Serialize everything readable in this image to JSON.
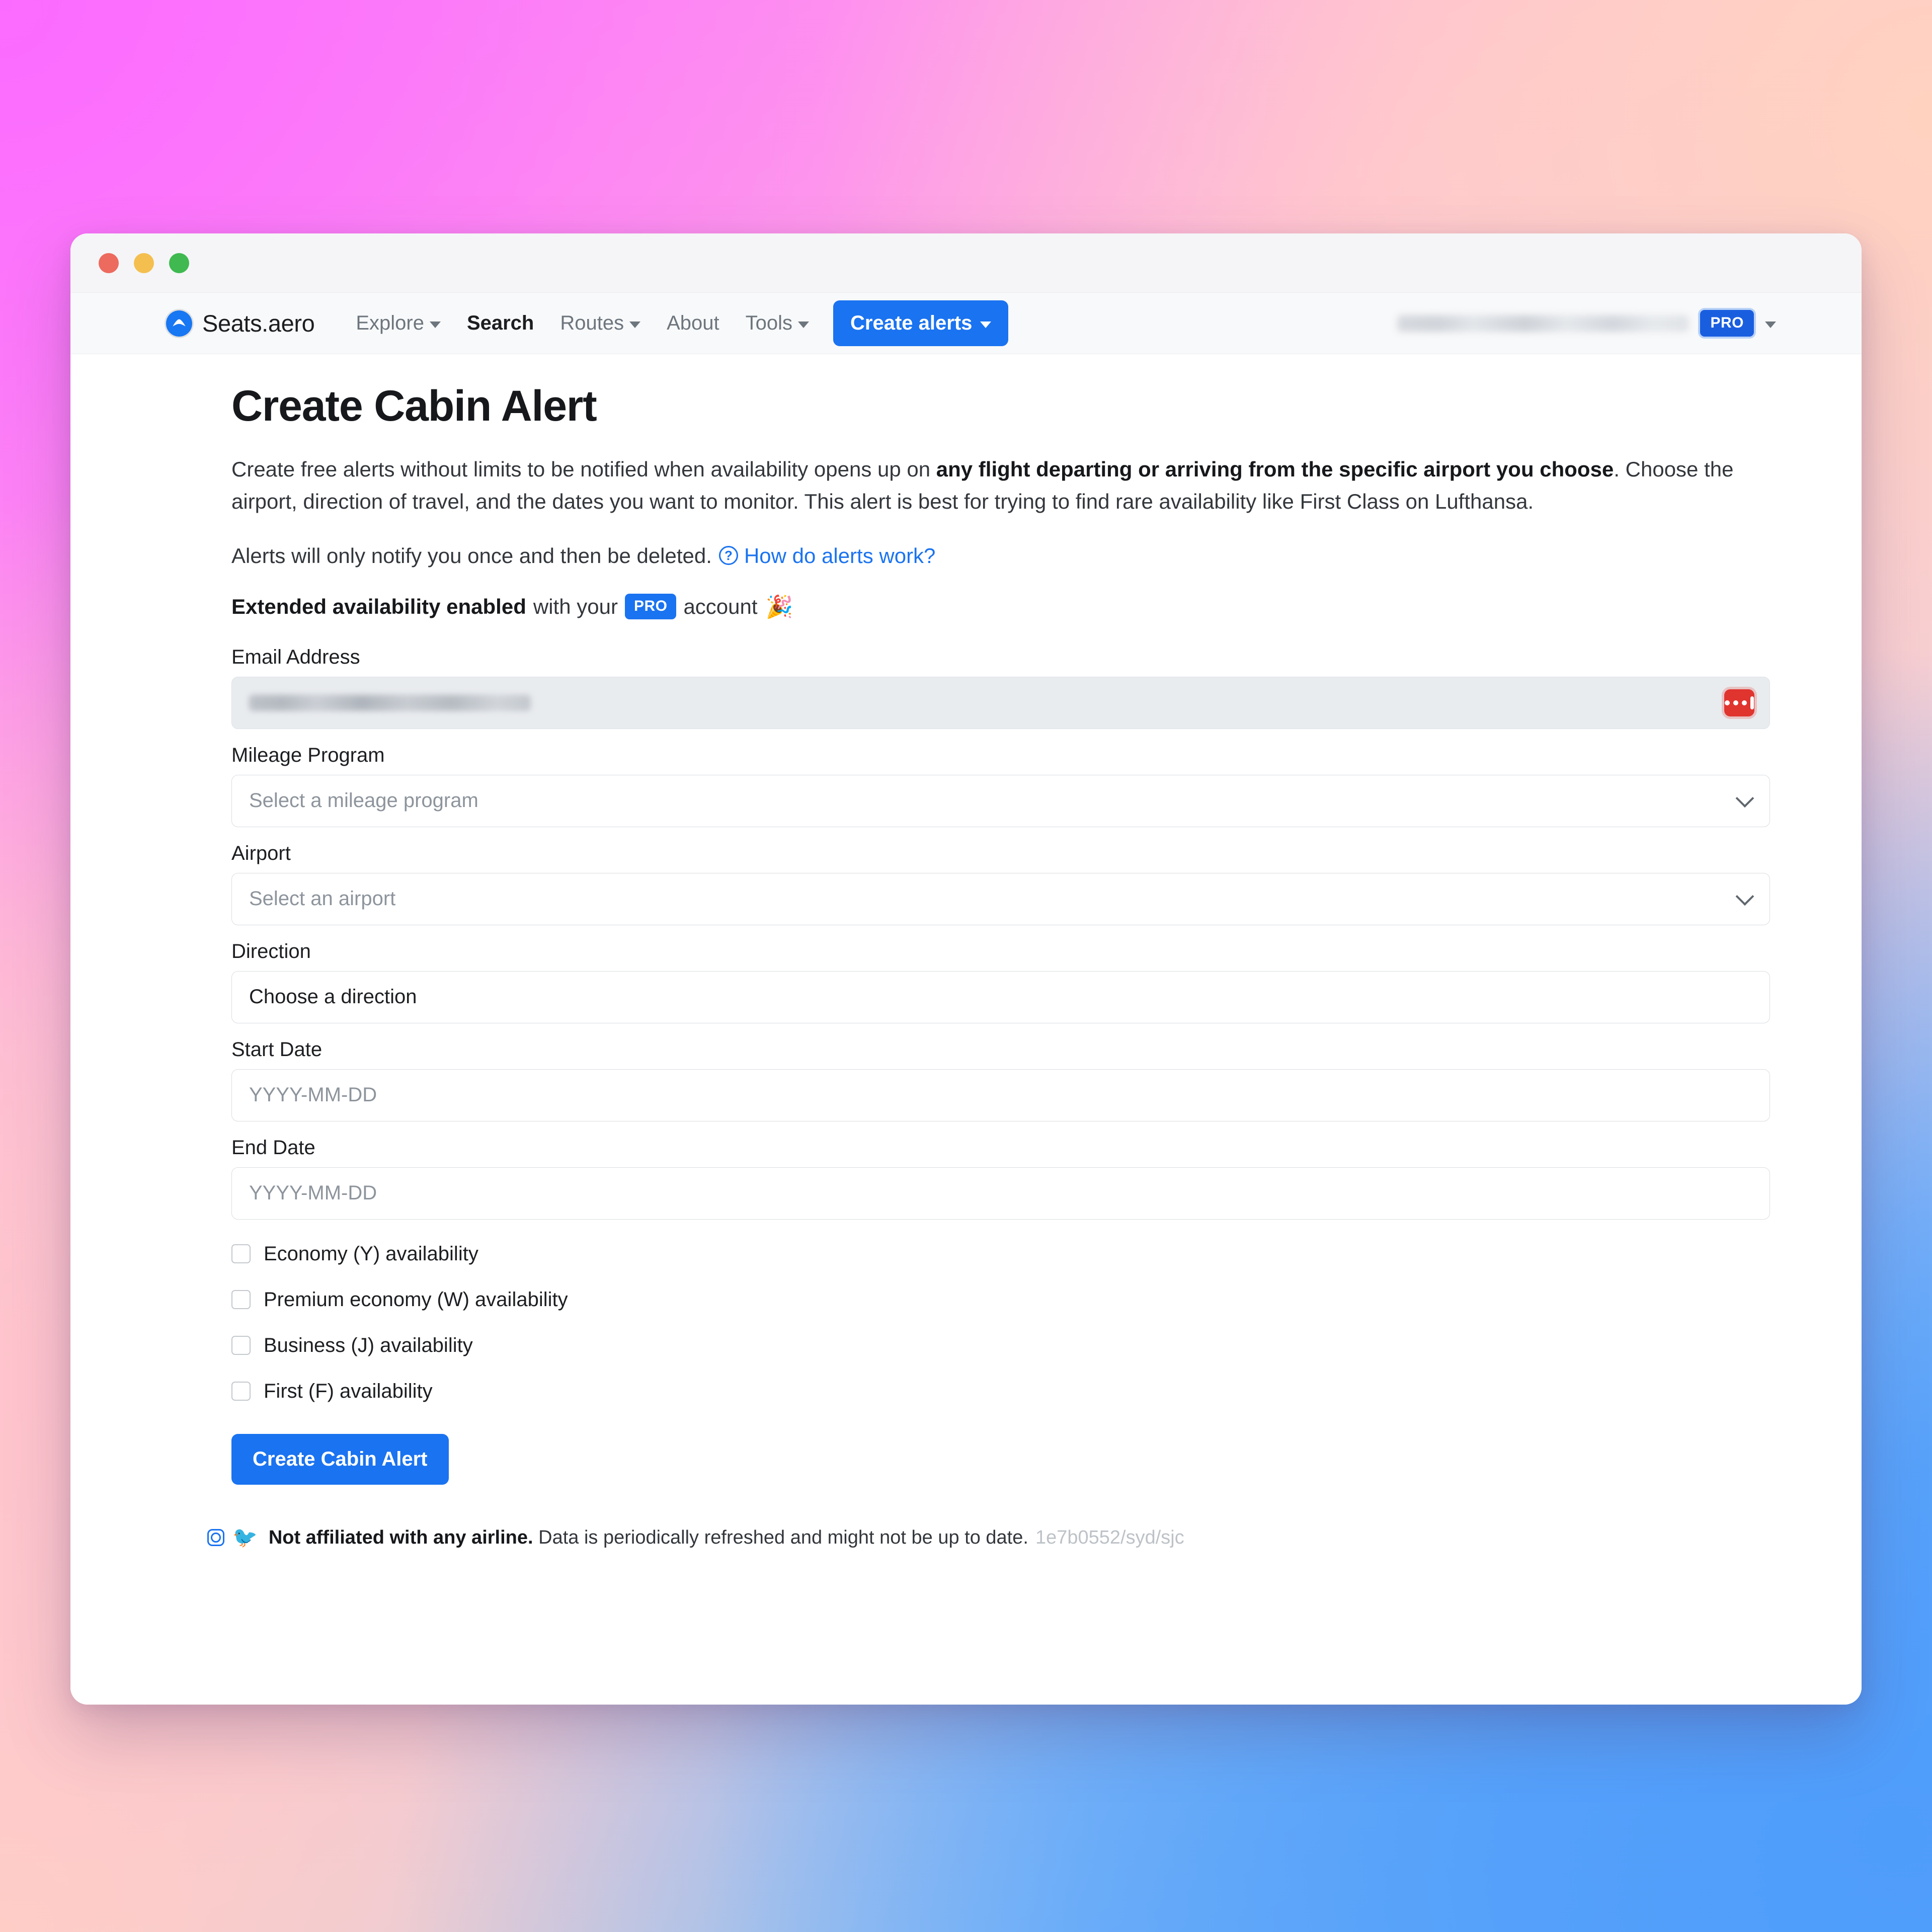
{
  "window": {
    "traffic_lights": [
      "close",
      "minimize",
      "zoom"
    ]
  },
  "navbar": {
    "brand": "Seats.aero",
    "links": [
      {
        "label": "Explore",
        "has_caret": true,
        "strong": false
      },
      {
        "label": "Search",
        "has_caret": false,
        "strong": true
      },
      {
        "label": "Routes",
        "has_caret": true,
        "strong": false
      },
      {
        "label": "About",
        "has_caret": false,
        "strong": false
      },
      {
        "label": "Tools",
        "has_caret": true,
        "strong": false
      }
    ],
    "cta_label": "Create alerts",
    "account": {
      "email_redacted": true,
      "badge": "PRO"
    },
    "accent_color": "#1a73f0"
  },
  "main": {
    "title": "Create Cabin Alert",
    "lede_part1": "Create free alerts without limits to be notified when availability opens up on ",
    "lede_bold": "any flight departing or arriving from the specific airport you choose",
    "lede_part2": ". Choose the airport, direction of travel, and the dates you want to monitor. This alert is best for trying to find rare availability like First Class on Lufthansa.",
    "alerts_note": "Alerts will only notify you once and then be deleted.",
    "alerts_help_icon": "question-circle-icon",
    "alerts_help_link": "How do alerts work?",
    "extended_bold": "Extended availability enabled",
    "extended_mid": "with your",
    "extended_badge": "PRO",
    "extended_tail": "account",
    "extended_emoji": "🎉"
  },
  "form": {
    "email": {
      "label": "Email Address",
      "value_redacted": true,
      "readonly": true,
      "icon": "password-manager-icon"
    },
    "mileage_program": {
      "label": "Mileage Program",
      "placeholder": "Select a mileage program",
      "value": ""
    },
    "airport": {
      "label": "Airport",
      "placeholder": "Select an airport",
      "value": ""
    },
    "direction": {
      "label": "Direction",
      "value": "Choose a direction"
    },
    "start_date": {
      "label": "Start Date",
      "placeholder": "YYYY-MM-DD",
      "value": ""
    },
    "end_date": {
      "label": "End Date",
      "placeholder": "YYYY-MM-DD",
      "value": ""
    },
    "checkboxes": [
      {
        "label": "Economy (Y) availability",
        "checked": false
      },
      {
        "label": "Premium economy (W) availability",
        "checked": false
      },
      {
        "label": "Business (J) availability",
        "checked": false
      },
      {
        "label": "First (F) availability",
        "checked": false
      }
    ],
    "submit_label": "Create Cabin Alert"
  },
  "footer": {
    "instagram_icon": "instagram-icon",
    "twitter_icon": "twitter-icon",
    "bold": "Not affiliated with any airline.",
    "text": "Data is periodically refreshed and might not be up to date.",
    "hash": "1e7b0552/syd/sjc"
  }
}
